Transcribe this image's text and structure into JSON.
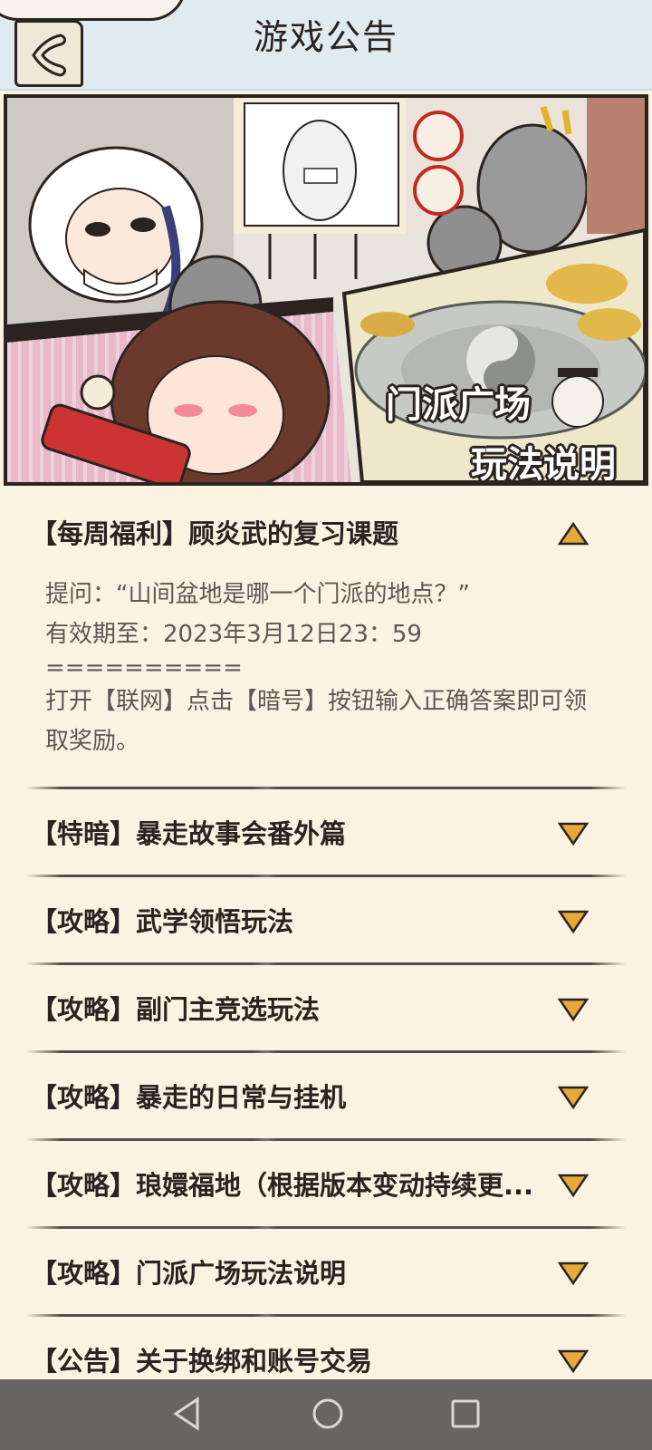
{
  "header": {
    "title": "游戏公告",
    "back_icon": "back-arrow-icon"
  },
  "banner": {
    "line1": "门派广场",
    "line2": "玩法说明"
  },
  "announcements": [
    {
      "title": "【每周福利】顾炎武的复习课题",
      "expanded": true,
      "body": [
        "提问：“山间盆地是哪一个门派的地点？”",
        "",
        "有效期至：2023年3月12日23：59",
        "==========",
        "打开【联网】点击【暗号】按钮输入正确答案即可领取奖励。"
      ]
    },
    {
      "title": "【特暗】暴走故事会番外篇",
      "expanded": false
    },
    {
      "title": "【攻略】武学领悟玩法",
      "expanded": false
    },
    {
      "title": "【攻略】副门主竞选玩法",
      "expanded": false
    },
    {
      "title": "【攻略】暴走的日常与挂机",
      "expanded": false
    },
    {
      "title": "【攻略】琅嬛福地（根据版本变动持续更...",
      "expanded": false
    },
    {
      "title": "【攻略】门派广场玩法说明",
      "expanded": false
    },
    {
      "title": "【公告】关于换绑和账号交易",
      "expanded": false
    }
  ],
  "colors": {
    "triangle": "#e7a938",
    "background": "#fbf3e2",
    "header": "#dfeaf1"
  },
  "navbar": {
    "back": "nav-back-icon",
    "home": "nav-home-icon",
    "recent": "nav-recent-icon"
  }
}
